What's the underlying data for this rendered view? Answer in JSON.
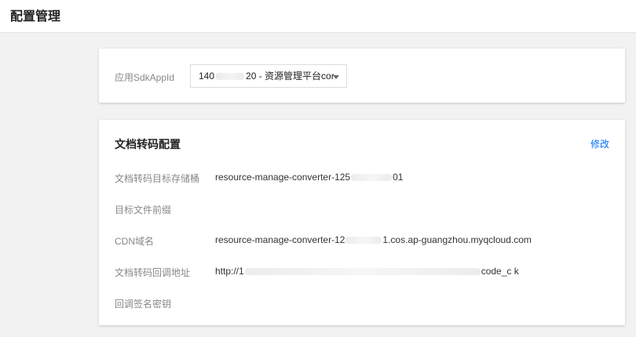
{
  "page": {
    "title": "配置管理"
  },
  "app_selector": {
    "label": "应用SdkAppId",
    "selected_prefix": "140",
    "selected_suffix": "20 - 资源管理平台cor"
  },
  "doc_conversion": {
    "title": "文档转码配置",
    "edit_label": "修改",
    "rows": [
      {
        "label": "文档转码目标存储桶",
        "value_prefix": "resource-manage-converter-125",
        "value_suffix": "01"
      },
      {
        "label": "目标文件前缀",
        "value_prefix": "",
        "value_suffix": ""
      },
      {
        "label": "CDN域名",
        "value_prefix": "resource-manage-converter-12",
        "value_suffix": "1.cos.ap-guangzhou.myqcloud.com"
      },
      {
        "label": "文档转码回调地址",
        "value_prefix": "http://1",
        "value_suffix": "code_c    k"
      },
      {
        "label": "回调签名密钥",
        "value_prefix": "",
        "value_suffix": ""
      }
    ]
  }
}
